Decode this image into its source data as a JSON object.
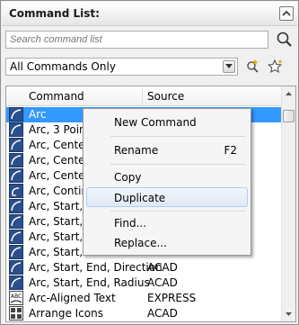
{
  "header": {
    "title": "Command List:"
  },
  "search": {
    "placeholder": "Search command list"
  },
  "filter": {
    "selected": "All Commands Only"
  },
  "list": {
    "columns": {
      "command": "Command",
      "source": "Source"
    },
    "rows": [
      {
        "command": "Arc",
        "source": "",
        "icon": "arc-icon"
      },
      {
        "command": "Arc, 3 Points",
        "source": "",
        "icon": "arc-icon"
      },
      {
        "command": "Arc, Center, ",
        "source": "",
        "icon": "arc-icon"
      },
      {
        "command": "Arc, Center, ",
        "source": "",
        "icon": "arc-icon"
      },
      {
        "command": "Arc, Center, ",
        "source": "",
        "icon": "arc-icon"
      },
      {
        "command": "Arc, Continue",
        "source": "",
        "icon": "arc-continue-icon"
      },
      {
        "command": "Arc, Start, Ce",
        "source": "",
        "icon": "arc-icon"
      },
      {
        "command": "Arc, Start, Ce",
        "source": "",
        "icon": "arc-icon"
      },
      {
        "command": "Arc, Start, Ce",
        "source": "",
        "icon": "arc-icon"
      },
      {
        "command": "Arc, Start, En",
        "source": "",
        "icon": "arc-icon"
      },
      {
        "command": "Arc, Start, End, Direction",
        "source": "ACAD",
        "icon": "arc-icon"
      },
      {
        "command": "Arc, Start, End, Radius",
        "source": "ACAD",
        "icon": "arc-icon"
      },
      {
        "command": "Arc-Aligned Text",
        "source": "EXPRESS",
        "icon": "arc-text-icon"
      },
      {
        "command": "Arrange Icons",
        "source": "ACAD",
        "icon": "grid-icon"
      }
    ]
  },
  "context_menu": {
    "items": [
      {
        "label": "New Command",
        "shortcut": ""
      },
      {
        "label": "Rename",
        "shortcut": "F2"
      },
      {
        "label": "Copy",
        "shortcut": ""
      },
      {
        "label": "Duplicate",
        "shortcut": ""
      },
      {
        "label": "Find...",
        "shortcut": ""
      },
      {
        "label": "Replace...",
        "shortcut": ""
      }
    ]
  },
  "colors": {
    "selection": "#3399ff",
    "menu_hover": "#dfe9f5"
  }
}
